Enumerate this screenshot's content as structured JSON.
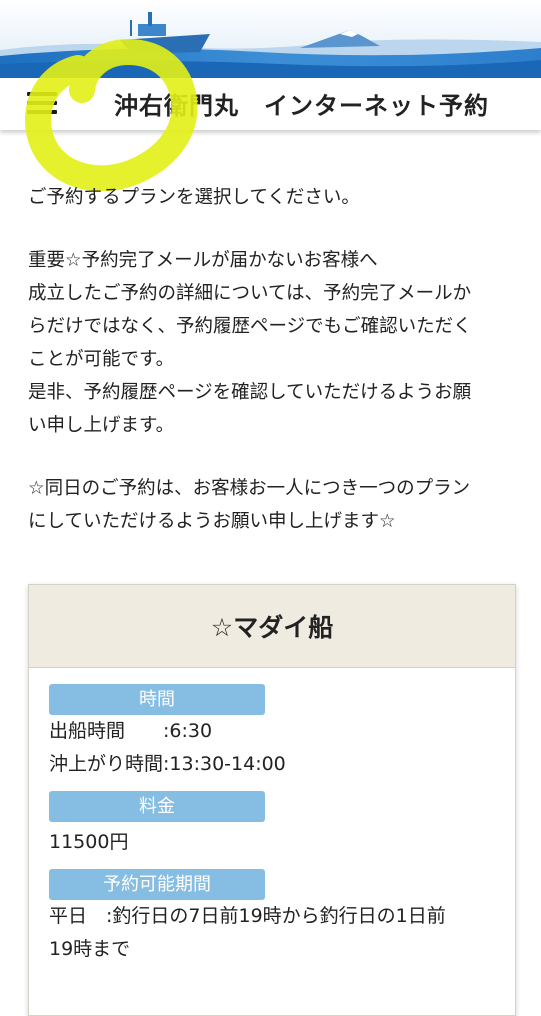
{
  "header": {
    "title": "沖右衛門丸　インターネット予約"
  },
  "intro": {
    "select_plan": "ご予約するプランを選択してください。",
    "important_lines": [
      "重要☆予約完了メールが届かないお客様へ",
      "成立したご予約の詳細については、予約完了メールか",
      "らだけではなく、予約履歴ページでもご確認いただく",
      "ことが可能です。",
      "是非、予約履歴ページを確認していただけるようお願",
      "い申し上げます。"
    ],
    "notice_lines": [
      "☆同日のご予約は、お客様お一人につき一つのプラン",
      "にしていただけるようお願い申し上げます☆"
    ]
  },
  "plan": {
    "title": "☆マダイ船",
    "time_label": "時間",
    "departure": "出船時間　　:6:30",
    "return": "沖上がり時間:13:30-14:00",
    "fee_label": "料金",
    "price": "11500円",
    "period_label": "予約可能期間",
    "weekday": "平日　:釣行日の7日前19時から釣行日の1日前",
    "weekday_cont": "19時まで"
  },
  "colors": {
    "badge": "#86bde3",
    "card_header": "#efebe1",
    "highlight": "#e3f016"
  }
}
